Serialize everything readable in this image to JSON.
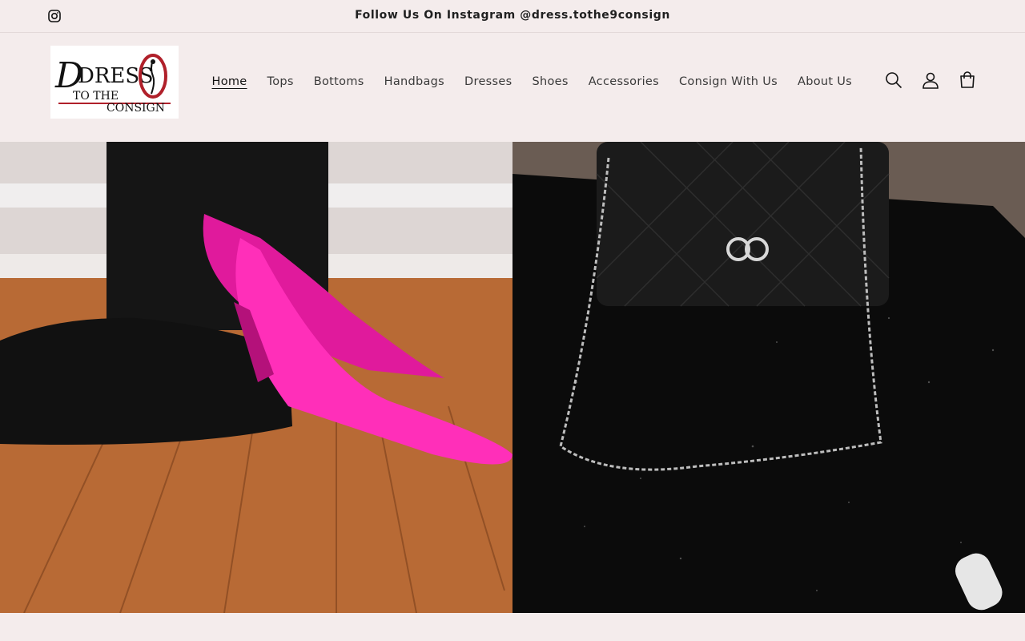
{
  "announcement": {
    "instagram_icon": "instagram-icon",
    "text": "Follow Us On Instagram @dress.tothe9consign"
  },
  "logo": {
    "line1": "DRESS",
    "line2": "TO THE",
    "line3": "CONSIGN",
    "numeral": "9"
  },
  "nav": {
    "items": [
      {
        "label": "Home",
        "active": true
      },
      {
        "label": "Tops"
      },
      {
        "label": "Bottoms"
      },
      {
        "label": "Handbags"
      },
      {
        "label": "Dresses"
      },
      {
        "label": "Shoes"
      },
      {
        "label": "Accessories"
      },
      {
        "label": "Consign With Us"
      },
      {
        "label": "About Us"
      }
    ]
  },
  "header_icons": [
    "search-icon",
    "account-icon",
    "cart-icon"
  ],
  "hero": {
    "left_image": "pink-pumps-photo",
    "right_image": "black-quilted-handbag-photo"
  },
  "colors": {
    "background": "#f4ecec",
    "text": "#121212",
    "logo_accent": "#b0202a"
  }
}
